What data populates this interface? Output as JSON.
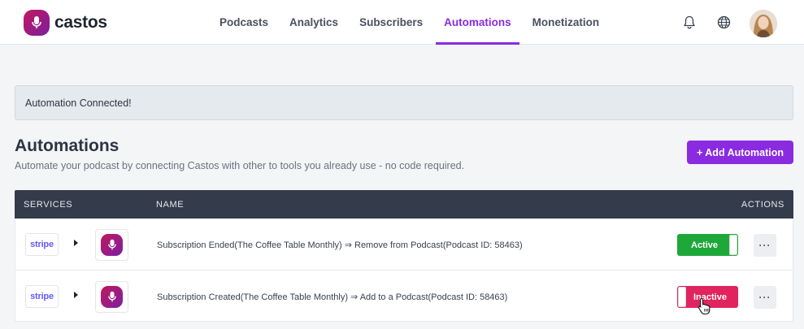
{
  "header": {
    "brand": "castos",
    "nav": [
      {
        "label": "Podcasts",
        "active": false
      },
      {
        "label": "Analytics",
        "active": false
      },
      {
        "label": "Subscribers",
        "active": false
      },
      {
        "label": "Automations",
        "active": true
      },
      {
        "label": "Monetization",
        "active": false
      }
    ],
    "icons": [
      "bell-icon",
      "globe-icon"
    ],
    "accent_color": "#8a2be2"
  },
  "alert": {
    "text": "Automation Connected!"
  },
  "page": {
    "title": "Automations",
    "subtitle": "Automate your podcast by connecting Castos with other to tools you already use - no code required.",
    "add_button": "+ Add Automation"
  },
  "table": {
    "columns": {
      "services": "SERVICES",
      "name": "NAME",
      "actions": "ACTIONS"
    },
    "rows": [
      {
        "service_from": "stripe",
        "name": "Subscription Ended(The Coffee Table Monthly) ⇒ Remove from Podcast(Podcast ID: 58463)",
        "status": "Active",
        "status_color": "#1fa83a",
        "more": "···"
      },
      {
        "service_from": "stripe",
        "name": "Subscription Created(The Coffee Table Monthly) ⇒ Add to a Podcast(Podcast ID: 58463)",
        "status": "Inactive",
        "status_color": "#e0245e",
        "more": "···"
      }
    ]
  }
}
